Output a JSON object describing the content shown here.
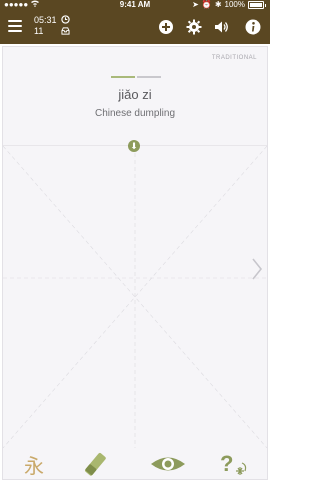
{
  "status_bar": {
    "time": "9:41 AM",
    "battery": "100%"
  },
  "toolbar": {
    "timer_minutes": "05:31",
    "timer_count": "11",
    "icons": [
      "menu-icon",
      "clock-icon",
      "tray-icon",
      "plus-icon",
      "gear-icon",
      "speaker-icon",
      "info-icon"
    ]
  },
  "card": {
    "script_label": "TRADITIONAL",
    "progress_fraction": 0.5,
    "pinyin": "jiǎo zi",
    "meaning": "Chinese dumpling"
  },
  "bottom_bar": {
    "stroke_order_char": "永",
    "icons": [
      "stroke-order-icon",
      "eraser-icon",
      "eye-icon",
      "question-icon"
    ]
  },
  "colors": {
    "header": "#5a4722",
    "accent": "#8d9b5c",
    "panel": "#f6f5f8"
  }
}
